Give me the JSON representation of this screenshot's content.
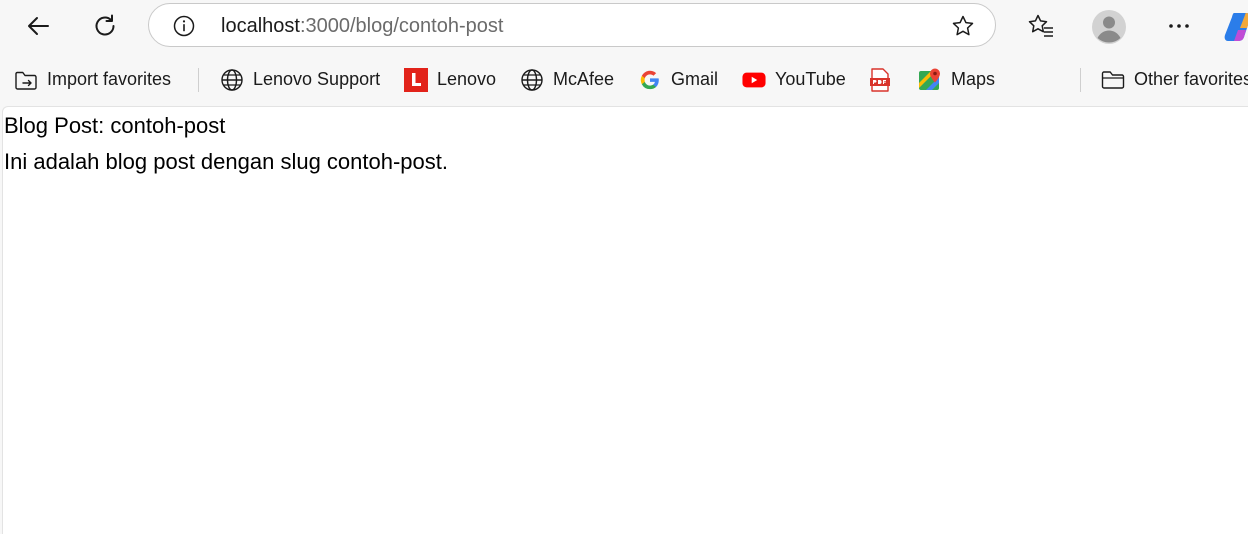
{
  "browser": {
    "address_bar": {
      "host": "localhost",
      "path": ":3000/blog/contoh-post"
    }
  },
  "favorites": {
    "import": "Import favorites",
    "items": [
      "Lenovo Support",
      "Lenovo",
      "McAfee",
      "Gmail",
      "YouTube",
      "Maps"
    ],
    "other": "Other favorites"
  },
  "page": {
    "title": "Blog Post: contoh-post",
    "body": "Ini adalah blog post dengan slug contoh-post."
  },
  "icons": {
    "back": "arrow-left-icon",
    "refresh": "refresh-icon",
    "info": "info-icon",
    "favorite": "star-icon",
    "favorites_list": "favorites-list-icon",
    "profile": "avatar-icon",
    "more": "more-icon",
    "copilot": "copilot-icon",
    "globe": "globe-icon",
    "folder": "folder-icon"
  },
  "colors": {
    "lenovo_red": "#e2231a",
    "youtube_red": "#ff0000",
    "pdf_red": "#d9342b"
  }
}
